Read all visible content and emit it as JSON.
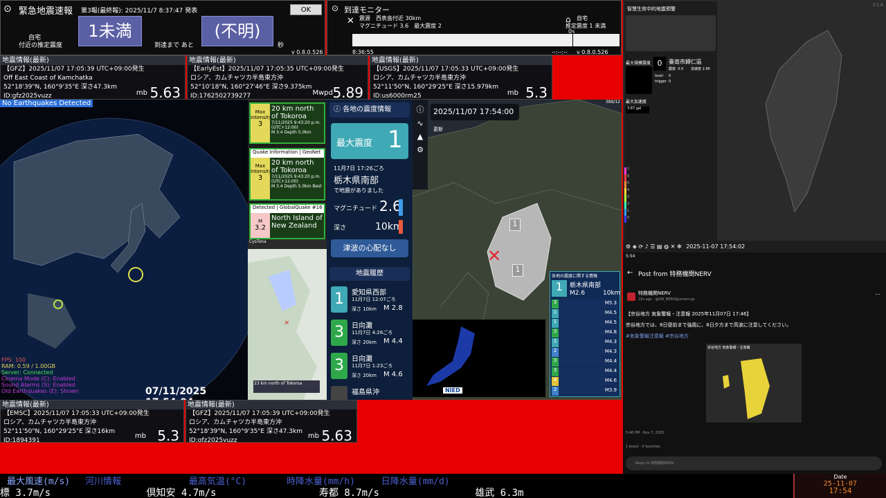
{
  "eew": {
    "title": "緊急地震速報",
    "report": "第3報(最終報): 2025/11/7 8:37:47 発表",
    "ok_label": "OK",
    "place_label": "自宅",
    "place_sub": "付近の推定震度",
    "intensity": "1未満",
    "arrival_label": "到達まで あと",
    "arrival_value": "(不明)",
    "sec_label": "秒",
    "version": "v 0.8.0.526"
  },
  "arrival": {
    "title": "到達モニター",
    "epicenter": "震源　西表島付近 30km",
    "magnitude": "マグニチュード 3.6　最大震度 2",
    "home_label": "自宅",
    "home_intensity": "推定震度 1 未満",
    "zero": "0s",
    "time": "8:36:55",
    "clock": "--:--:--",
    "version": "v 0.8.0.526"
  },
  "quakes_top": [
    {
      "header": "地震情報(最新)",
      "src": "【GFZ】2025/11/07 17:05:39 UTC+09:00発生",
      "place": "Off East Coast of Kamchatka",
      "coords": "52°18'39\"N, 160°9'35\"E 深さ47.3km",
      "id": "ID:gfz2025vuzz",
      "mag_label": "mb",
      "mag": "5.63"
    },
    {
      "header": "地震情報(最新)",
      "src": "【EarlyEst】2025/11/07 17:05:35 UTC+09:00発生",
      "place": "ロシア、カムチャツカ半島東方沖",
      "coords": "52°10'18\"N, 160°27'46\"E 深さ9.375km",
      "id": "ID:1762502739277",
      "mag_label": "Mwpd",
      "mag": "5.89"
    },
    {
      "header": "地震情報(最新)",
      "src": "【USGS】2025/11/07 17:05:33 UTC+09:00発生",
      "place": "ロシア、カムチャツカ半島東方沖",
      "coords": "52°11'50\"N, 160°29'25\"E 深さ15.979km",
      "id": "ID:us6000rm25",
      "mag_label": "mb",
      "mag": "5.3"
    }
  ],
  "quakes_bottom": [
    {
      "header": "地震情報(最新)",
      "src": "【EMSC】2025/11/07 17:05:33 UTC+09:00発生",
      "place": "ロシア、カムチャツカ半島東方沖",
      "coords": "52°11'50\"N, 160°29'25\"E 深さ16km",
      "id": "ID:1894391",
      "mag_label": "mb",
      "mag": "5.3"
    },
    {
      "header": "地震情報(最新)",
      "src": "【GFZ】2025/11/07 17:05:39 UTC+09:00発生",
      "place": "ロシア、カムチャツカ半島東方沖",
      "coords": "52°18'39\"N, 160°9'35\"E 深さ47.3km",
      "id": "ID:gfz2025vuzz",
      "mag_label": "mb",
      "mag": "5.63"
    }
  ],
  "globe": {
    "banner": "No Earthquakes Detected",
    "stats": [
      "FPS: 100",
      "RAM: 0.59 / 1.00GB",
      "Server: Connected",
      "Cinema Mode (C): Enabled",
      "Sound Alarms (S): Enabled",
      "Old Earthquakes (E): Shown"
    ],
    "time": "07/11/2025 17:54:04"
  },
  "gq_cards": [
    {
      "side": "Max Intensity",
      "lvl": "3",
      "place": "20 km north of Tokoroa",
      "date": "7/11/2025 9:43:20 p.m. (UTC+12:00)",
      "meta": "M 3.4  Depth 5.0km"
    },
    {
      "header": "Quake Information | GeoNet",
      "side": "Max Intensity",
      "lvl": "3",
      "place": "20 km north of Tokoroa",
      "date": "7/11/2025 9:43:20 p.m. (UTC+12:00)",
      "meta": "M 3.4  Depth 5.0km  Best"
    },
    {
      "header": "Detected | GlobalQuake  #16",
      "side": "M",
      "lvl": "3.2",
      "place": "North Island of New Zealand",
      "date": "",
      "meta": ""
    }
  ],
  "nz_map": {
    "logo": "CysTona",
    "caption": "23 km north of Tokoroa"
  },
  "jp": {
    "title": "各地の震度情報",
    "max_label": "最大震度",
    "max_value": "1",
    "date": "11月7日 17:26ごろ",
    "region": "栃木県南部",
    "note": "で地震がありました",
    "mag_label": "マグニチュード",
    "mag": "2.6",
    "depth_label": "深さ",
    "depth": "10km",
    "tsunami": "津波の心配なし",
    "history_title": "地震履歴",
    "history": [
      {
        "lvl": "1",
        "place": "愛知県西部",
        "date": "11月7日 12:07ごろ",
        "depth": "深さ 10km",
        "mag": "M 2.8"
      },
      {
        "lvl": "3",
        "place": "日向灘",
        "date": "11月7日 4:26ごろ",
        "depth": "深さ 20km",
        "mag": "M 4.4"
      },
      {
        "lvl": "3",
        "place": "日向灘",
        "date": "11月7日 1:23ごろ",
        "depth": "深さ 20km",
        "mag": "M 4.6"
      },
      {
        "lvl": "",
        "place": "福島県沖",
        "date": "",
        "depth": "",
        "mag": ""
      }
    ]
  },
  "jpmap": {
    "datetime": "2025/11/07  17:54:00",
    "update": "更新",
    "corner": "389/12",
    "int1": "1",
    "int2": "1",
    "side_title": "各地の震度に関する情報",
    "side_lvl": "1",
    "side_place": "栃木県南部",
    "side_mag": "M2.6",
    "side_depth": "10km",
    "side_list": [
      {
        "lvl": "3",
        "mag": "M5.3"
      },
      {
        "lvl": "1",
        "mag": "M4.5"
      },
      {
        "lvl": "1",
        "mag": "M4.5"
      },
      {
        "lvl": "3",
        "mag": "M4.8"
      },
      {
        "lvl": "1",
        "mag": "M4.3"
      },
      {
        "lvl": "2",
        "mag": "M4.3"
      },
      {
        "lvl": "3",
        "mag": "M4.4"
      },
      {
        "lvl": "3",
        "mag": "M4.4"
      },
      {
        "lvl": "4",
        "mag": "M4.6"
      },
      {
        "lvl": "2",
        "mag": "M3.9"
      }
    ],
    "nied": "NIED"
  },
  "tw": {
    "title": "智慧生效中的地震預警",
    "max_label": "最大規模震度",
    "zero": "0",
    "station": "臺南市歸仁區",
    "station_sub1": "震度 -3.0",
    "station_sub2": "加速度 2.96",
    "level_l": "level",
    "level_v": "0",
    "trigger_l": "trigger",
    "trigger_v": "0",
    "max_acc_label": "最大加速度",
    "max_acc": "3.87 gal",
    "version": "3.1.6",
    "datetime": "2025-11-07 17:54:02",
    "scale": [
      "7",
      "6",
      "5",
      "4",
      "3",
      "2",
      "1",
      "0"
    ]
  },
  "post": {
    "status_time": "5:54",
    "title": "Post from 特務機関NERV",
    "author": "特務機関NERV",
    "handle": "22s ago · @UN_NERV@unnerv.jp",
    "line1": "【宗谷地方 気象警報・注意報 2025年11月07日 17:46】",
    "line2": "宗谷地方では、8日昼前まで強風に、8日夕方まで高波に注意してください。",
    "tags": "#気象警報注意報 #宗谷地方",
    "img_title": "宗谷地方 気象警報・注意報",
    "foot_time": "5:46 PM · Nov 7, 2025",
    "boosts": "1 boost · 0 favorites",
    "reply": "Reply to 特務機関NERV"
  },
  "ticker": {
    "row1": [
      "最大風速(m/s)",
      "河川情報",
      "最高気温(°C)",
      "時降水量(mm/h)",
      "日降水量(mm/d)"
    ],
    "row2": [
      "標 3.7m/s",
      "倶知安 4.7m/s",
      "寿都 8.7m/s",
      "雄武 6.3m"
    ],
    "date_label": "Date",
    "date": "25-11-07",
    "time": "17:54"
  }
}
